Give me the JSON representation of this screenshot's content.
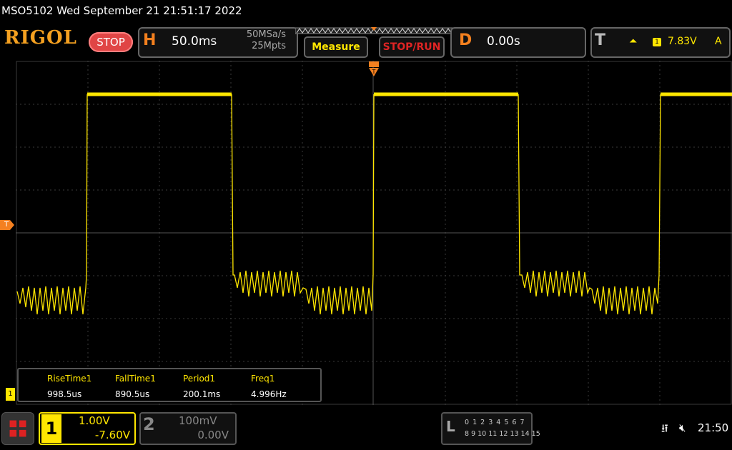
{
  "header": {
    "title": "MSO5102  Wed September 21 21:51:17 2022",
    "logo": "RIGOL",
    "run_state": "STOP",
    "horizontal": {
      "letter": "H",
      "timebase": "50.0ms",
      "sample_rate": "50MSa/s",
      "memory_depth": "25Mpts"
    },
    "measure_label": "Measure",
    "stop_run_label": "STOP/RUN",
    "delay": {
      "letter": "D",
      "value": "0.00s"
    },
    "trigger": {
      "letter": "T",
      "edge_icon": "rising-edge-icon",
      "source": "1",
      "level": "7.83V",
      "mode": "A"
    }
  },
  "colors": {
    "ch1": "#ffe600",
    "accent": "#f4801e",
    "stop": "#e04545",
    "grid": "#3a3a3a"
  },
  "markers": {
    "trigger_level": "T",
    "ch1_ground": "1"
  },
  "measurements": [
    {
      "label": "RiseTime1",
      "value": "998.5us"
    },
    {
      "label": "FallTime1",
      "value": "890.5us"
    },
    {
      "label": "Period1",
      "value": "200.1ms"
    },
    {
      "label": "Freq1",
      "value": "4.996Hz"
    }
  ],
  "channels": {
    "ch1": {
      "number": "1",
      "scale": "1.00V",
      "offset": "-7.60V",
      "active": true
    },
    "ch2": {
      "number": "2",
      "scale": "100mV",
      "offset": "0.00V",
      "active": false
    }
  },
  "logic": {
    "letter": "L",
    "row1": "0 1 2 3  4 5 6 7",
    "row2": "8 9 10 11 12 13 14 15"
  },
  "status": {
    "usb_icon": "usb-icon",
    "sound_icon": "speaker-muted-icon",
    "time": "21:50"
  }
}
